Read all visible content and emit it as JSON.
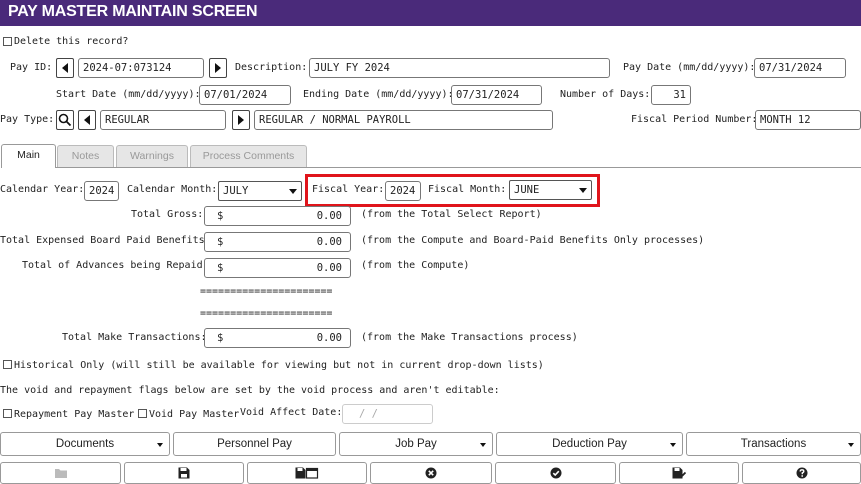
{
  "header": {
    "title": "PAY MASTER MAINTAIN SCREEN"
  },
  "delete_label": "Delete this record?",
  "pay_id": {
    "label": "Pay ID:",
    "value": "2024-07:073124"
  },
  "description": {
    "label": "Description:",
    "value": "JULY FY 2024"
  },
  "pay_date": {
    "label": "Pay Date (mm/dd/yyyy):",
    "value": "07/31/2024"
  },
  "start_date": {
    "label": "Start Date (mm/dd/yyyy):",
    "value": "07/01/2024"
  },
  "ending_date": {
    "label": "Ending Date (mm/dd/yyyy):",
    "value": "07/31/2024"
  },
  "num_days": {
    "label": "Number of Days:",
    "value": "31"
  },
  "pay_type": {
    "label": "Pay Type:",
    "code": "REGULAR",
    "description": "REGULAR / NORMAL PAYROLL"
  },
  "fiscal_period": {
    "label": "Fiscal Period Number:",
    "value": "MONTH 12"
  },
  "tabs": [
    "Main",
    "Notes",
    "Warnings",
    "Process Comments"
  ],
  "calendar_year": {
    "label": "Calendar Year:",
    "value": "2024"
  },
  "calendar_month": {
    "label": "Calendar Month:",
    "value": "JULY"
  },
  "fiscal_year": {
    "label": "Fiscal Year:",
    "value": "2024"
  },
  "fiscal_month": {
    "label": "Fiscal Month:",
    "value": "JUNE"
  },
  "total_gross": {
    "label": "Total Gross:",
    "currency": "$",
    "value": "0.00",
    "note": "(from the Total Select Report)"
  },
  "expensed": {
    "label": "Total Expensed Board Paid Benefits:",
    "currency": "$",
    "value": "0.00",
    "note": "(from the Compute and Board-Paid Benefits Only processes)"
  },
  "advances": {
    "label": "Total of Advances being Repaid:",
    "currency": "$",
    "value": "0.00",
    "note": "(from the Compute)"
  },
  "separator": "======================",
  "make_trans": {
    "label": "Total Make Transactions:",
    "currency": "$",
    "value": "0.00",
    "note": "(from the Make Transactions process)"
  },
  "historical_label": "Historical Only (will still be available for viewing but not in current drop-down lists)",
  "void_note": "The void and repayment flags below are set by the void process and aren't editable:",
  "repayment_label": "Repayment Pay Master",
  "void_pm_label": "Void Pay Master",
  "void_date": {
    "label": "Void Affect Date:",
    "placeholder": "/ /"
  },
  "buttons": [
    "Documents",
    "Personnel Pay",
    "Job Pay",
    "Deduction Pay",
    "Transactions"
  ],
  "icons": [
    "folder-icon",
    "save-icon",
    "save-copy-icon",
    "cancel-icon",
    "check-icon",
    "save-check-icon",
    "help-icon"
  ],
  "colors": {
    "header": "#4a2a7a",
    "highlight": "#e0141b"
  }
}
